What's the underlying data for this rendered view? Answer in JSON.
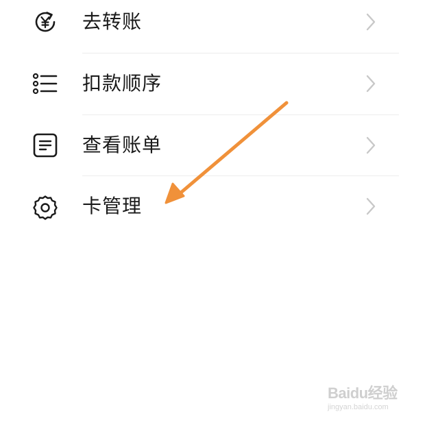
{
  "menu": {
    "items": [
      {
        "label": "去转账",
        "icon": "yuan-transfer-icon"
      },
      {
        "label": "扣款顺序",
        "icon": "list-icon"
      },
      {
        "label": "查看账单",
        "icon": "document-icon"
      },
      {
        "label": "卡管理",
        "icon": "gear-icon"
      }
    ]
  },
  "annotation": {
    "arrow_color": "#f0913a"
  },
  "watermark": {
    "brand": "Baidu经验",
    "url": "jingyan.baidu.com"
  },
  "colors": {
    "text": "#1a1a1a",
    "icon": "#1a1a1a",
    "chevron": "#c8c8c8",
    "divider": "#ececec",
    "arrow": "#f0913a",
    "watermark": "#cfcfcf"
  }
}
